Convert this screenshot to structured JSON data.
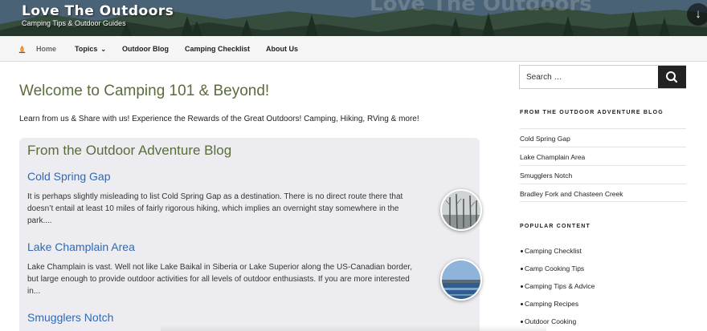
{
  "header": {
    "site_title": "Love The Outdoors",
    "tagline": "Camping Tips & Outdoor Guides",
    "watermark": "Love The Outdoors",
    "scroll_icon": "arrow-down-icon"
  },
  "nav": {
    "home": "Home",
    "topics": "Topics",
    "outdoor_blog": "Outdoor Blog",
    "camping_checklist": "Camping Checklist",
    "about_us": "About Us"
  },
  "main": {
    "title": "Welcome to Camping 101 & Beyond!",
    "intro": "Learn from us & Share with us! Experience the Rewards of the Great Outdoors! Camping, Hiking, RVing & more!",
    "blog_heading": "From the Outdoor Adventure Blog",
    "posts": [
      {
        "title": "Cold Spring Gap",
        "excerpt": "It is perhaps slightly misleading to list Cold Spring Gap as a destination. There is no direct route there that doesn’t entail at least 10 miles of fairly rigorous hiking, which implies an overnight stay somewhere in the park...."
      },
      {
        "title": "Lake Champlain Area",
        "excerpt": "Lake Champlain is vast. Well not like Lake Baikal in Siberia or Lake Superior along the US-Canadian border, but large enough to provide outdoor activities for all levels of outdoor enthusiasts. If you are more interested in..."
      },
      {
        "title": "Smugglers Notch",
        "excerpt": ""
      }
    ]
  },
  "sidebar": {
    "search_placeholder": "Search …",
    "blog_widget_title": "FROM THE OUTDOOR ADVENTURE BLOG",
    "blog_links": [
      "Cold Spring Gap",
      "Lake Champlain Area",
      "Smugglers Notch",
      "Bradley Fork and Chasteen Creek"
    ],
    "popular_title": "POPULAR CONTENT",
    "popular_links": [
      "Camping Checklist",
      "Camp Cooking Tips",
      "Camping Tips & Advice",
      "Camping Recipes",
      "Outdoor Cooking"
    ]
  }
}
